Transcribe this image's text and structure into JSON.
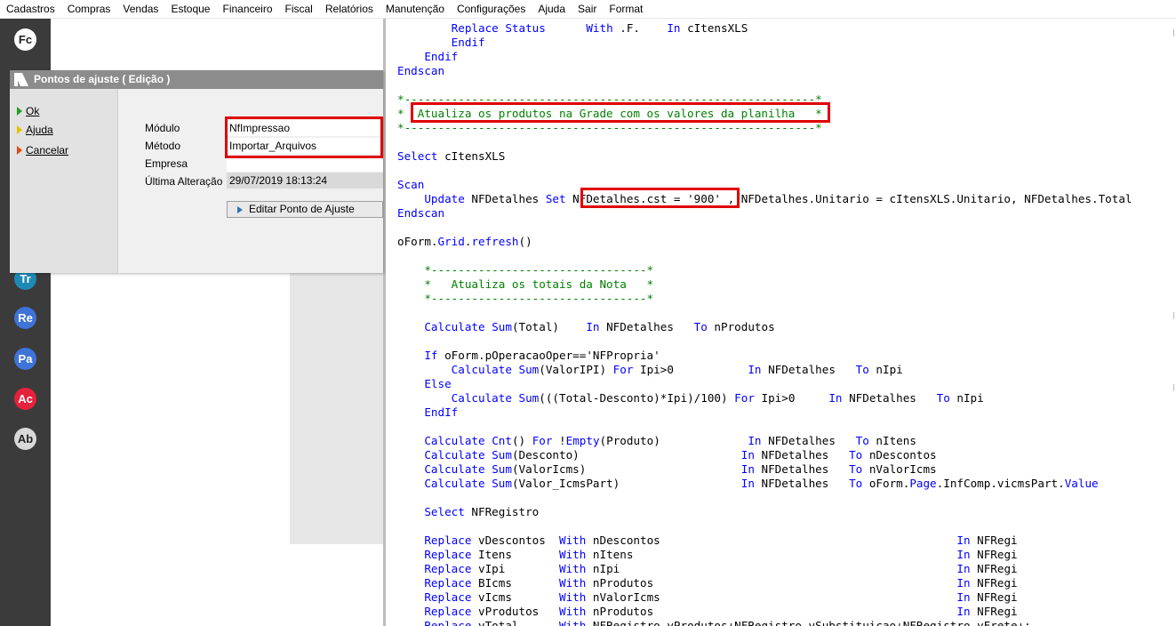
{
  "menu": [
    "Cadastros",
    "Compras",
    "Vendas",
    "Estoque",
    "Financeiro",
    "Fiscal",
    "Relatórios",
    "Manutenção",
    "Configurações",
    "Ajuda",
    "Sair",
    "Format"
  ],
  "sidebar": {
    "icons": [
      {
        "label": "Fc",
        "color": "#ffffff",
        "text_color": "#222222"
      },
      {
        "label": "Tr",
        "color": "#1d8ab5",
        "text_color": "#ffffff"
      },
      {
        "label": "Re",
        "color": "#3e73d8",
        "text_color": "#ffffff"
      },
      {
        "label": "Pa",
        "color": "#3e73d8",
        "text_color": "#ffffff"
      },
      {
        "label": "Ac",
        "color": "#e5223c",
        "text_color": "#ffffff"
      },
      {
        "label": "Ab",
        "color": "#d9d9d9",
        "text_color": "#222222"
      }
    ]
  },
  "dialog": {
    "title": "Pontos de ajuste ( Edição )",
    "actions": [
      {
        "label": "Ok",
        "color": "#22a022"
      },
      {
        "label": "Ajuda",
        "color": "#e8c000"
      },
      {
        "label": "Cancelar",
        "color": "#e04a1a"
      }
    ],
    "fields": [
      {
        "label": "Módulo",
        "value": "NfImpressao"
      },
      {
        "label": "Método",
        "value": "Importar_Arquivos"
      },
      {
        "label": "Empresa",
        "value": ""
      },
      {
        "label": "Última Alteração",
        "value": "29/07/2019 18:13:24"
      }
    ],
    "button_label": "Editar Ponto de Ajuste"
  },
  "code_lines": [
    [
      [
        "        ",
        ""
      ],
      [
        "Replace Status",
        "kw"
      ],
      [
        "      ",
        ""
      ],
      [
        "With",
        "kw"
      ],
      [
        " .F.    ",
        ""
      ],
      [
        "In",
        "kw"
      ],
      [
        " cItensXLS",
        ""
      ]
    ],
    [
      [
        "        Endif",
        "kw"
      ]
    ],
    [
      [
        "    Endif",
        "kw"
      ]
    ],
    [
      [
        "Endscan",
        "kw"
      ]
    ],
    [],
    [
      [
        "*-------------------------------------------------------------*",
        "cm"
      ]
    ],
    [
      [
        "*  Atualiza os produtos na Grade com os valores da planilha   *",
        "cm"
      ]
    ],
    [
      [
        "*-------------------------------------------------------------*",
        "cm"
      ]
    ],
    [],
    [
      [
        "Select",
        "kw"
      ],
      [
        " cItensXLS",
        ""
      ]
    ],
    [],
    [
      [
        "Scan",
        "kw"
      ]
    ],
    [
      [
        "    ",
        ""
      ],
      [
        "Update",
        "kw"
      ],
      [
        " NFDetalhes ",
        ""
      ],
      [
        "Set",
        "kw"
      ],
      [
        " NFDetalhes.cst = '900' , NFDetalhes.Unitario = cItensXLS.Unitario, NFDetalhes.Total",
        ""
      ]
    ],
    [
      [
        "Endscan",
        "kw"
      ]
    ],
    [],
    [
      [
        "oForm.",
        ""
      ],
      [
        "Grid",
        "kw"
      ],
      [
        ".",
        ""
      ],
      [
        "refresh",
        "kw"
      ],
      [
        "()",
        ""
      ]
    ],
    [],
    [
      [
        "    *--------------------------------*",
        "cm"
      ]
    ],
    [
      [
        "    *   Atualiza os totais da Nota   *",
        "cm"
      ]
    ],
    [
      [
        "    *--------------------------------*",
        "cm"
      ]
    ],
    [],
    [
      [
        "    ",
        ""
      ],
      [
        "Calculate",
        "kw"
      ],
      [
        " ",
        ""
      ],
      [
        "Sum",
        "kw"
      ],
      [
        "(Total)    ",
        ""
      ],
      [
        "In",
        "kw"
      ],
      [
        " NFDetalhes   ",
        ""
      ],
      [
        "To",
        "kw"
      ],
      [
        " nProdutos",
        ""
      ]
    ],
    [],
    [
      [
        "    ",
        ""
      ],
      [
        "If",
        "kw"
      ],
      [
        " oForm.pOperacaoOper=='NFPropria'",
        ""
      ]
    ],
    [
      [
        "        ",
        ""
      ],
      [
        "Calculate",
        "kw"
      ],
      [
        " ",
        ""
      ],
      [
        "Sum",
        "kw"
      ],
      [
        "(ValorIPI) ",
        ""
      ],
      [
        "For",
        "kw"
      ],
      [
        " Ipi>0           ",
        ""
      ],
      [
        "In",
        "kw"
      ],
      [
        " NFDetalhes   ",
        ""
      ],
      [
        "To",
        "kw"
      ],
      [
        " nIpi",
        ""
      ]
    ],
    [
      [
        "    ",
        ""
      ],
      [
        "Else",
        "kw"
      ]
    ],
    [
      [
        "        ",
        ""
      ],
      [
        "Calculate",
        "kw"
      ],
      [
        " ",
        ""
      ],
      [
        "Sum",
        "kw"
      ],
      [
        "(((Total-Desconto)*Ipi)/100) ",
        ""
      ],
      [
        "For",
        "kw"
      ],
      [
        " Ipi>0     ",
        ""
      ],
      [
        "In",
        "kw"
      ],
      [
        " NFDetalhes   ",
        ""
      ],
      [
        "To",
        "kw"
      ],
      [
        " nIpi",
        ""
      ]
    ],
    [
      [
        "    ",
        ""
      ],
      [
        "EndIf",
        "kw"
      ]
    ],
    [],
    [
      [
        "    ",
        ""
      ],
      [
        "Calculate",
        "kw"
      ],
      [
        " ",
        ""
      ],
      [
        "Cnt",
        "kw"
      ],
      [
        "() ",
        ""
      ],
      [
        "For",
        "kw"
      ],
      [
        " !",
        ""
      ],
      [
        "Empty",
        "kw"
      ],
      [
        "(Produto)             ",
        ""
      ],
      [
        "In",
        "kw"
      ],
      [
        " NFDetalhes   ",
        ""
      ],
      [
        "To",
        "kw"
      ],
      [
        " nItens",
        ""
      ]
    ],
    [
      [
        "    ",
        ""
      ],
      [
        "Calculate",
        "kw"
      ],
      [
        " ",
        ""
      ],
      [
        "Sum",
        "kw"
      ],
      [
        "(Desconto)                        ",
        ""
      ],
      [
        "In",
        "kw"
      ],
      [
        " NFDetalhes   ",
        ""
      ],
      [
        "To",
        "kw"
      ],
      [
        " nDescontos",
        ""
      ]
    ],
    [
      [
        "    ",
        ""
      ],
      [
        "Calculate",
        "kw"
      ],
      [
        " ",
        ""
      ],
      [
        "Sum",
        "kw"
      ],
      [
        "(ValorIcms)                       ",
        ""
      ],
      [
        "In",
        "kw"
      ],
      [
        " NFDetalhes   ",
        ""
      ],
      [
        "To",
        "kw"
      ],
      [
        " nValorIcms",
        ""
      ]
    ],
    [
      [
        "    ",
        ""
      ],
      [
        "Calculate",
        "kw"
      ],
      [
        " ",
        ""
      ],
      [
        "Sum",
        "kw"
      ],
      [
        "(Valor_IcmsPart)                  ",
        ""
      ],
      [
        "In",
        "kw"
      ],
      [
        " NFDetalhes   ",
        ""
      ],
      [
        "To",
        "kw"
      ],
      [
        " oForm.",
        ""
      ],
      [
        "Page",
        "kw"
      ],
      [
        ".InfComp.vicmsPart.",
        ""
      ],
      [
        "Value",
        "kw"
      ]
    ],
    [],
    [
      [
        "    ",
        ""
      ],
      [
        "Select",
        "kw"
      ],
      [
        " NFRegistro",
        ""
      ]
    ],
    [],
    [
      [
        "    ",
        ""
      ],
      [
        "Replace",
        "kw"
      ],
      [
        " vDescontos  ",
        ""
      ],
      [
        "With",
        "kw"
      ],
      [
        " nDescontos                                            ",
        ""
      ],
      [
        "In",
        "kw"
      ],
      [
        " NFRegi",
        ""
      ]
    ],
    [
      [
        "    ",
        ""
      ],
      [
        "Replace",
        "kw"
      ],
      [
        " Itens       ",
        ""
      ],
      [
        "With",
        "kw"
      ],
      [
        " nItens                                                ",
        ""
      ],
      [
        "In",
        "kw"
      ],
      [
        " NFRegi",
        ""
      ]
    ],
    [
      [
        "    ",
        ""
      ],
      [
        "Replace",
        "kw"
      ],
      [
        " vIpi        ",
        ""
      ],
      [
        "With",
        "kw"
      ],
      [
        " nIpi                                                  ",
        ""
      ],
      [
        "In",
        "kw"
      ],
      [
        " NFRegi",
        ""
      ]
    ],
    [
      [
        "    ",
        ""
      ],
      [
        "Replace",
        "kw"
      ],
      [
        " BIcms       ",
        ""
      ],
      [
        "With",
        "kw"
      ],
      [
        " nProdutos                                             ",
        ""
      ],
      [
        "In",
        "kw"
      ],
      [
        " NFRegi",
        ""
      ]
    ],
    [
      [
        "    ",
        ""
      ],
      [
        "Replace",
        "kw"
      ],
      [
        " vIcms       ",
        ""
      ],
      [
        "With",
        "kw"
      ],
      [
        " nValorIcms                                            ",
        ""
      ],
      [
        "In",
        "kw"
      ],
      [
        " NFRegi",
        ""
      ]
    ],
    [
      [
        "    ",
        ""
      ],
      [
        "Replace",
        "kw"
      ],
      [
        " vProdutos   ",
        ""
      ],
      [
        "With",
        "kw"
      ],
      [
        " nProdutos                                             ",
        ""
      ],
      [
        "In",
        "kw"
      ],
      [
        " NFRegi",
        ""
      ]
    ],
    [
      [
        "    ",
        ""
      ],
      [
        "Replace",
        "kw"
      ],
      [
        " vTotal      ",
        ""
      ],
      [
        "With",
        "kw"
      ],
      [
        " NFRegistro.vProdutos+NFRegistro.vSubstituicao+NFRegistro.vFrete+;",
        ""
      ]
    ]
  ]
}
